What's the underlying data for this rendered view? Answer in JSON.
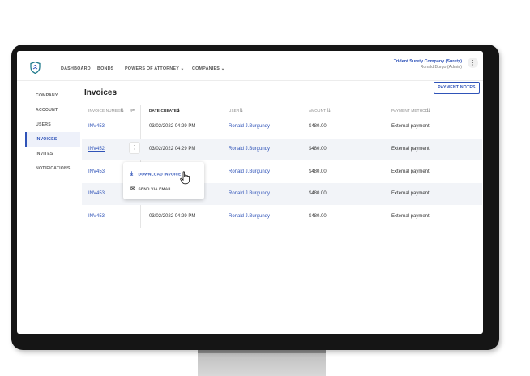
{
  "header": {
    "nav": [
      "DASHBOARD",
      "BONDS",
      "POWERS OF ATTORNEY",
      "COMPANIES"
    ],
    "company_name": "Trident Surety Company (Surety)",
    "user_role": "Ronald Burgo (Admin)"
  },
  "sidebar": {
    "items": [
      {
        "label": "COMPANY"
      },
      {
        "label": "ACCOUNT"
      },
      {
        "label": "USERS"
      },
      {
        "label": "INVOICES",
        "active": true
      },
      {
        "label": "INVITES"
      },
      {
        "label": "NOTIFICATIONS"
      }
    ]
  },
  "page": {
    "title": "Invoices",
    "notes_button": "PAYMENT NOTES"
  },
  "table": {
    "headers": [
      "INVOICE NUMBER",
      "DATE CREATED",
      "USER",
      "AMOUNT",
      "PAYMENT METHOD"
    ],
    "rows": [
      {
        "invoice": "INV453",
        "date": "03/02/2022 04:29 PM",
        "user": "Ronald J.Burgundy",
        "amount": "$480.00",
        "method": "External payment"
      },
      {
        "invoice": "INV452",
        "date": "03/02/2022 04:29 PM",
        "user": "Ronald J.Burgundy",
        "amount": "$480.00",
        "method": "External payment"
      },
      {
        "invoice": "INV453",
        "date": "",
        "user": "Ronald J.Burgundy",
        "amount": "$480.00",
        "method": "External payment"
      },
      {
        "invoice": "INV453",
        "date": "",
        "user": "Ronald J.Burgundy",
        "amount": "$480.00",
        "method": "External payment"
      },
      {
        "invoice": "INV453",
        "date": "03/02/2022 04:29 PM",
        "user": "Ronald J.Burgundy",
        "amount": "$480.00",
        "method": "External payment"
      }
    ]
  },
  "context_menu": {
    "download": "DOWNLOAD INVOICE",
    "email": "SEND VIA EMAIL"
  },
  "colors": {
    "accent": "#2f53b8",
    "row_shade": "#f2f4f8",
    "bezel": "#151515"
  },
  "icons": {
    "logo": "shield-logo",
    "download": "download-icon",
    "email": "mail-icon",
    "cursor": "hand-pointer-icon"
  }
}
